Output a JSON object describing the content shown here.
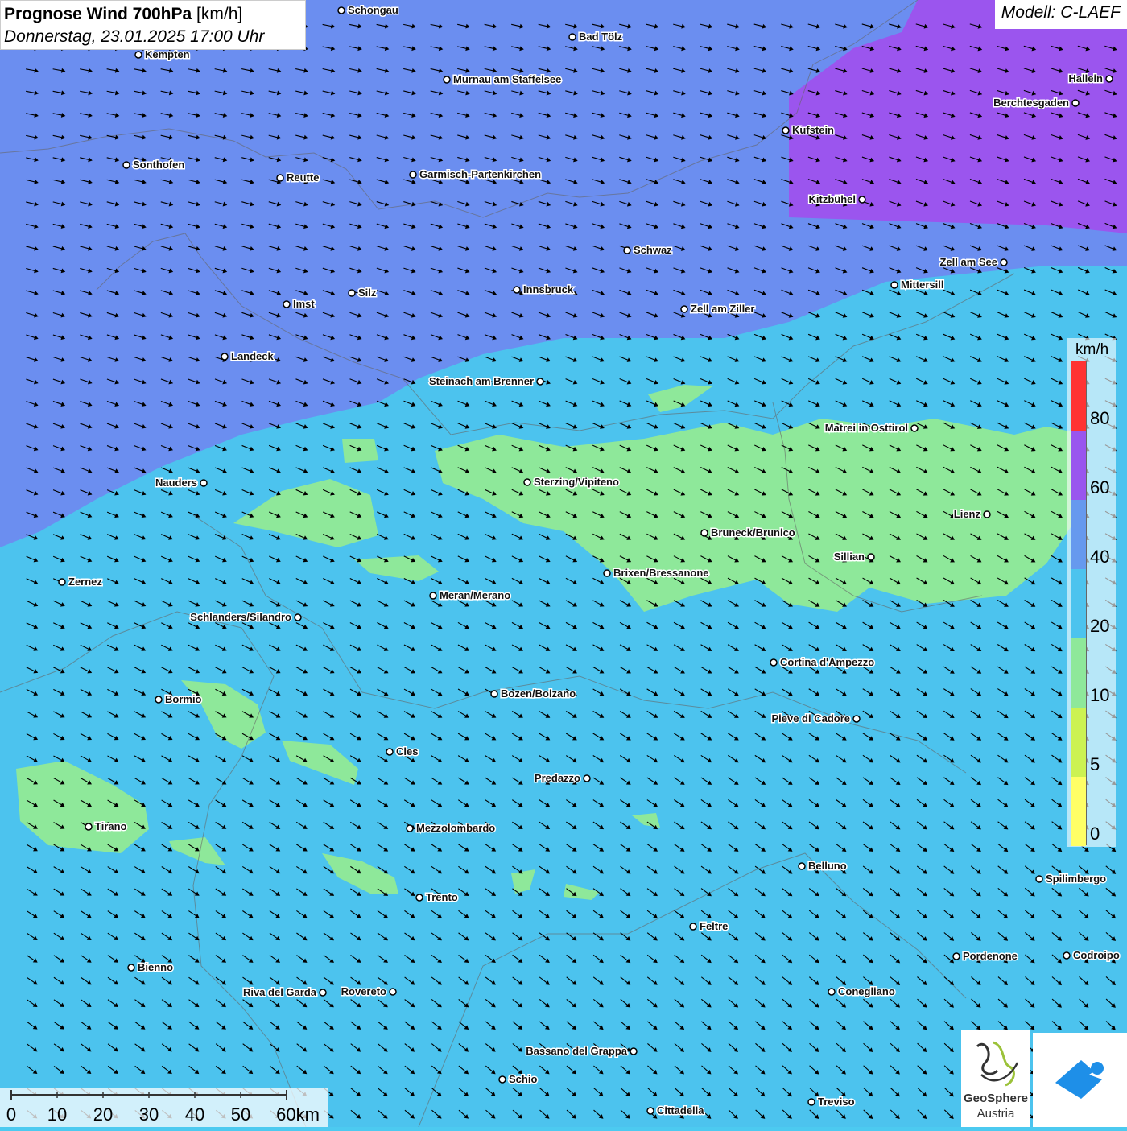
{
  "title": {
    "bold": "Prognose Wind 700hPa",
    "unit": "[km/h]",
    "datetime": "Donnerstag, 23.01.2025 17:00 Uhr"
  },
  "model": "Modell: C-LAEF",
  "legend": {
    "unit": "km/h",
    "ticks": [
      "80",
      "60",
      "40",
      "20",
      "10",
      "5",
      "0"
    ],
    "colors": [
      "#ffff66",
      "#ccf252",
      "#8ee89a",
      "#4cc3ee",
      "#6699ee",
      "#9955ee",
      "#ff3333"
    ]
  },
  "scalebar": {
    "labels": [
      "0",
      "10",
      "20",
      "30",
      "40",
      "50",
      "60km"
    ]
  },
  "logos": {
    "geosphere_line1": "GeoSphere",
    "geosphere_line2": "Austria"
  },
  "wind": {
    "direction": "west-northwest over north, northwest in south"
  },
  "cities": [
    {
      "name": "Schongau"
    },
    {
      "name": "Bad Tölz"
    },
    {
      "name": "Kempten"
    },
    {
      "name": "Murnau am Staffelsee"
    },
    {
      "name": "Hallein"
    },
    {
      "name": "Berchtesgaden"
    },
    {
      "name": "Kufstein"
    },
    {
      "name": "Sonthofen"
    },
    {
      "name": "Reutte"
    },
    {
      "name": "Garmisch-Partenkirchen"
    },
    {
      "name": "Kitzbühel"
    },
    {
      "name": "Schwaz"
    },
    {
      "name": "Zell am See"
    },
    {
      "name": "Mittersill"
    },
    {
      "name": "Silz"
    },
    {
      "name": "Innsbruck"
    },
    {
      "name": "Imst"
    },
    {
      "name": "Zell am Ziller"
    },
    {
      "name": "Landeck"
    },
    {
      "name": "Steinach am Brenner"
    },
    {
      "name": "Matrei in Osttirol"
    },
    {
      "name": "Nauders"
    },
    {
      "name": "Sterzing/Vipiteno"
    },
    {
      "name": "Lienz"
    },
    {
      "name": "Bruneck/Brunico"
    },
    {
      "name": "Sillian"
    },
    {
      "name": "Zernez"
    },
    {
      "name": "Brixen/Bressanone"
    },
    {
      "name": "Meran/Merano"
    },
    {
      "name": "Schlanders/Silandro"
    },
    {
      "name": "Cortina d'Ampezzo"
    },
    {
      "name": "Bozen/Bolzano"
    },
    {
      "name": "Bormio"
    },
    {
      "name": "Pieve di Cadore"
    },
    {
      "name": "Cles"
    },
    {
      "name": "Predazzo"
    },
    {
      "name": "Tirano"
    },
    {
      "name": "Mezzolombardo"
    },
    {
      "name": "Belluno"
    },
    {
      "name": "Spilimbergo"
    },
    {
      "name": "Trento"
    },
    {
      "name": "Feltre"
    },
    {
      "name": "Pordenone"
    },
    {
      "name": "Codroipo"
    },
    {
      "name": "Bienno"
    },
    {
      "name": "Riva del Garda"
    },
    {
      "name": "Rovereto"
    },
    {
      "name": "Conegliano"
    },
    {
      "name": "Bassano del Grappa"
    },
    {
      "name": "Schio"
    },
    {
      "name": "Treviso"
    },
    {
      "name": "Cittadella"
    }
  ]
}
